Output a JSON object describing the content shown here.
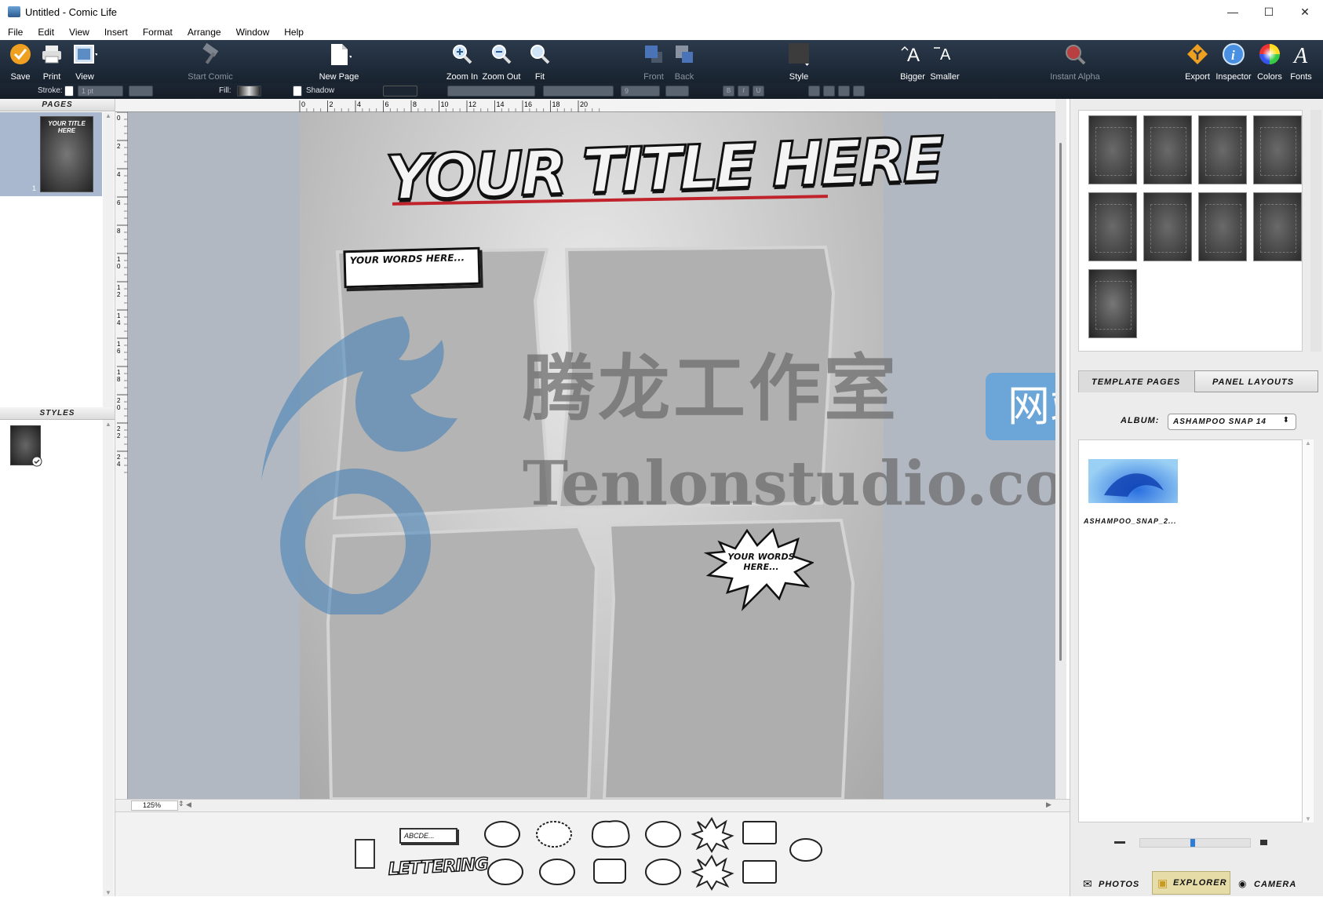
{
  "window": {
    "title": "Untitled - Comic Life",
    "minimize": "—",
    "maximize": "☐",
    "close": "✕"
  },
  "menu": [
    "File",
    "Edit",
    "View",
    "Insert",
    "Format",
    "Arrange",
    "Window",
    "Help"
  ],
  "toolbar": {
    "save": "Save",
    "print": "Print",
    "view": "View",
    "start_comic": "Start Comic",
    "new_page": "New Page",
    "zoom_in": "Zoom In",
    "zoom_out": "Zoom Out",
    "fit": "Fit",
    "front": "Front",
    "back": "Back",
    "style": "Style",
    "bigger": "Bigger",
    "smaller": "Smaller",
    "instant_alpha": "Instant Alpha",
    "export": "Export",
    "inspector": "Inspector",
    "colors": "Colors",
    "fonts": "Fonts"
  },
  "stylebar": {
    "stroke_label": "Stroke:",
    "stroke_value": "1 pt",
    "fill_label": "Fill:",
    "shadow_label": "Shadow",
    "font_size": "9",
    "bold": "B",
    "italic": "I",
    "underline": "U"
  },
  "left": {
    "pages_header": "PAGES",
    "page_number": "1",
    "styles_header": "STYLES",
    "page_thumb_title": "YOUR TITLE HERE"
  },
  "ruler": {
    "top_ticks": [
      "0",
      "2",
      "4",
      "6",
      "8",
      "10",
      "12",
      "14",
      "16",
      "18",
      "20"
    ],
    "left_ticks": [
      "0",
      "2",
      "4",
      "6",
      "8",
      "10",
      "12",
      "14",
      "16",
      "18",
      "20",
      "22",
      "24"
    ]
  },
  "page": {
    "title": "YOUR TITLE HERE",
    "caption": "YOUR WORDS HERE...",
    "burst": "YOUR WORDS HERE..."
  },
  "zoom": {
    "value": "125%"
  },
  "tray": {
    "caption_sample": "ABCDE...",
    "lettering": "LETTERING"
  },
  "right": {
    "tab_template": "TEMPLATE PAGES",
    "tab_layouts": "PANEL LAYOUTS",
    "album_label": "ALBUM:",
    "album_value": "ASHAMPOO SNAP 14",
    "photo_name": "ASHAMPOO_SNAP_2...",
    "tab_photos": "PHOTOS",
    "tab_explorer": "EXPLORER",
    "tab_camera": "CAMERA"
  },
  "watermark": {
    "cn": "腾龙工作室",
    "badge": "网站",
    "en": "Tenlonstudio.com"
  },
  "colors": {
    "toolbar": "#1f2a38",
    "canvas_bg": "#b2b8c2",
    "accent": "#f0a020"
  }
}
